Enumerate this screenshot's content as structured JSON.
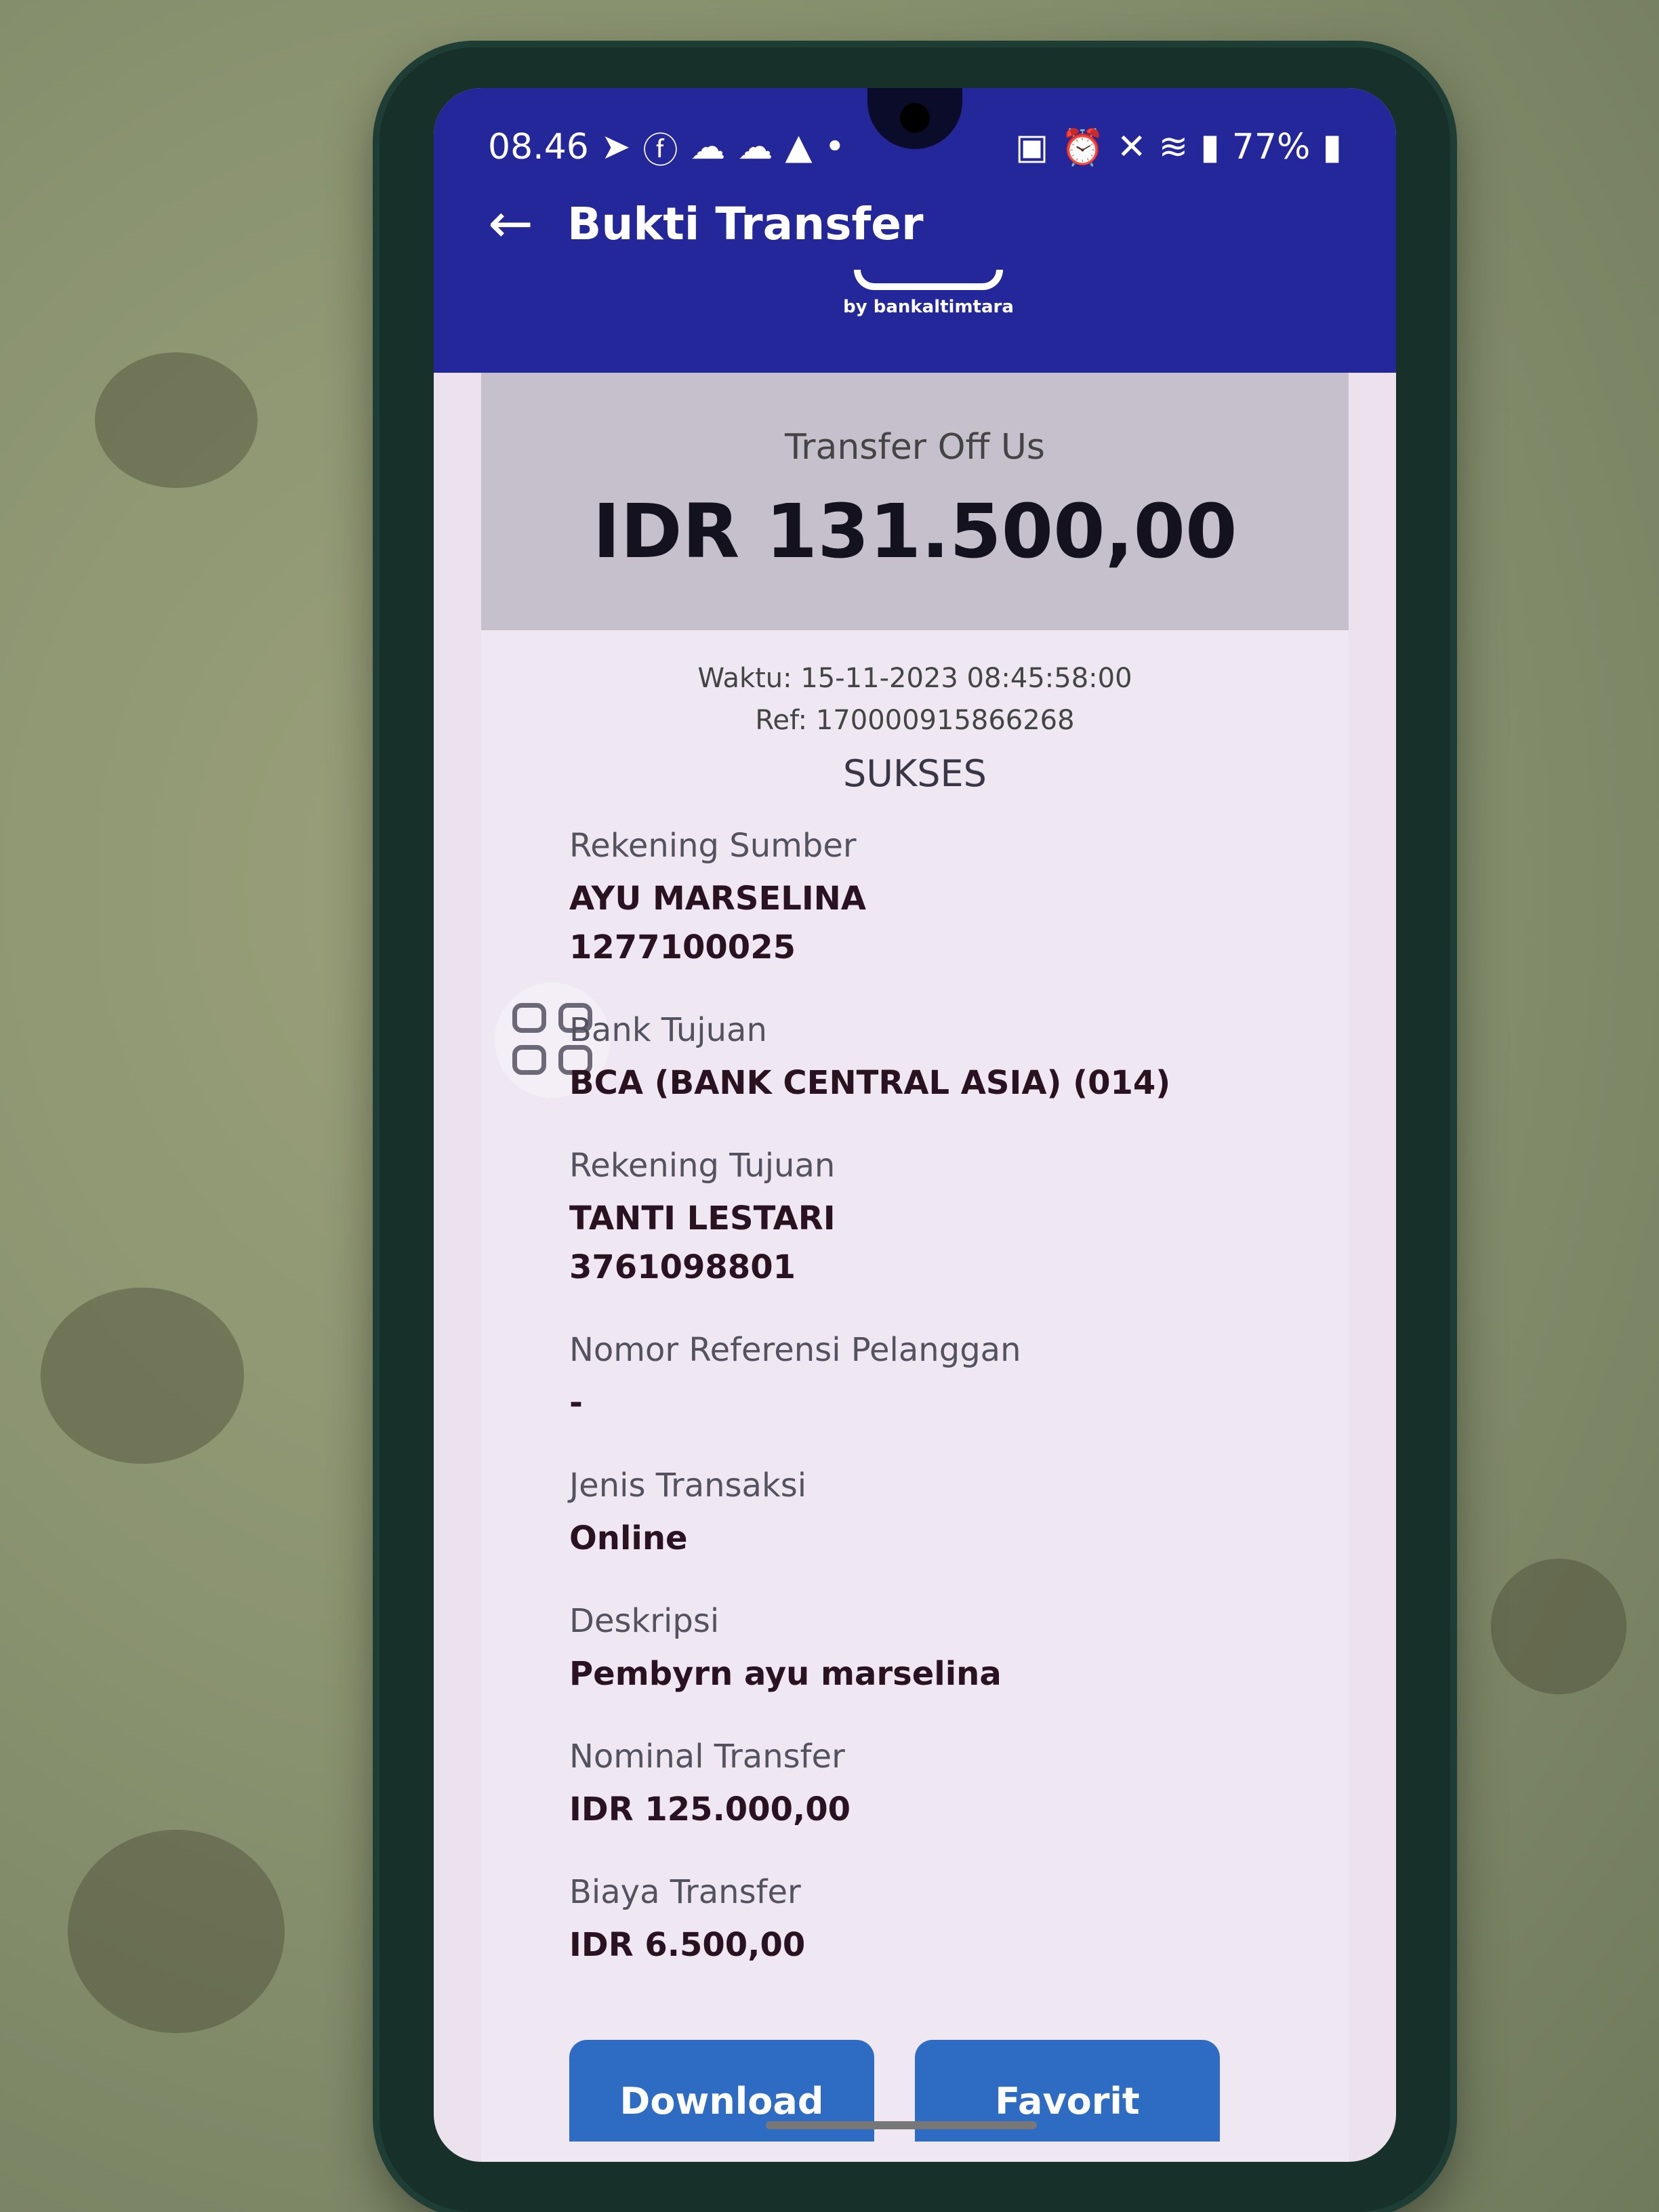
{
  "status_bar": {
    "time": "08.46",
    "left_icons": [
      "telegram-icon",
      "facebook-icon",
      "cloud-icon",
      "cloud-icon",
      "warning-icon",
      "dot-icon"
    ],
    "right_icons": [
      "battery-saver-icon",
      "alarm-icon",
      "mute-icon",
      "wifi-icon",
      "signal-icon"
    ],
    "battery": "77%"
  },
  "header": {
    "title": "Bukti Transfer",
    "logo_text": "by bankaltimtara",
    "color": "#24279a"
  },
  "summary": {
    "type": "Transfer Off Us",
    "amount": "IDR 131.500,00",
    "time": "Waktu: 15-11-2023 08:45:58:00",
    "ref": "Ref: 170000915866268",
    "status": "SUKSES"
  },
  "fields": {
    "source_label": "Rekening Sumber",
    "source_name": "AYU MARSELINA",
    "source_account": "1277100025",
    "bank_label": "Bank Tujuan",
    "bank_value": "BCA (BANK CENTRAL ASIA) (014)",
    "dest_label": "Rekening Tujuan",
    "dest_name": "TANTI LESTARI",
    "dest_account": "3761098801",
    "ref_label": "Nomor Referensi Pelanggan",
    "ref_value": "-",
    "type_label": "Jenis Transaksi",
    "type_value": "Online",
    "desc_label": "Deskripsi",
    "desc_value": "Pembyrn ayu marselina",
    "nominal_label": "Nominal Transfer",
    "nominal_value": "IDR 125.000,00",
    "fee_label": "Biaya Transfer",
    "fee_value": "IDR 6.500,00"
  },
  "actions": {
    "download": "Download",
    "favorite": "Favorit",
    "button_color": "#2e6cc4"
  }
}
